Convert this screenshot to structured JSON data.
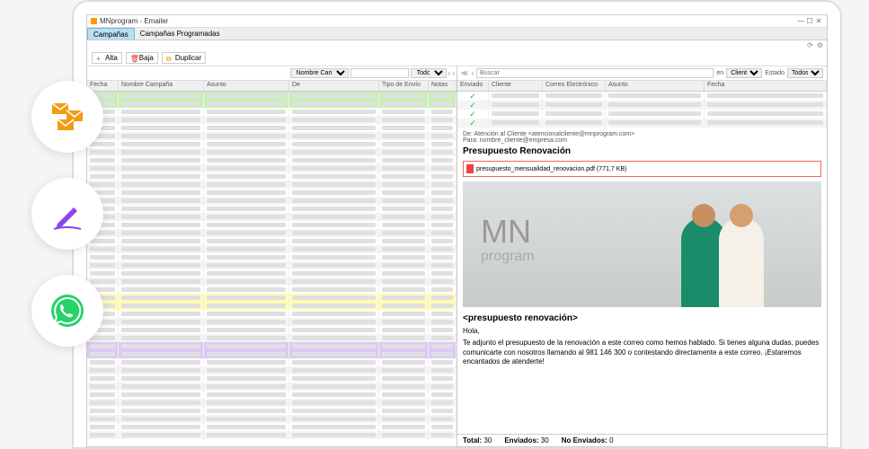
{
  "window": {
    "title": "MNprogram - Emailer"
  },
  "tabs": {
    "active": "Campañas",
    "other": "Campañas Programadas"
  },
  "toolbar": {
    "alta": "Alta",
    "baja": "Baja",
    "duplicar": "Duplicar"
  },
  "left_filters": {
    "nombre_label": "Nombre Campañ",
    "todos": "Todos"
  },
  "left_headers": {
    "fecha": "Fecha",
    "nombre": "Nombre Campaña",
    "asunto": "Asunto",
    "de": "De",
    "tipo": "Tipo de Envío",
    "notas": "Notas"
  },
  "right_filters": {
    "buscar_ph": "Buscar",
    "en": "en",
    "cliente": "Cliente",
    "estado": "Estado",
    "todos": "Todos"
  },
  "right_headers": {
    "enviado": "Enviado",
    "cliente": "Cliente",
    "correo": "Correo Electrónico",
    "asunto": "Asunto",
    "fecha": "Fecha"
  },
  "preview": {
    "from": "De: Atención al Cliente <atencionalcliente@mnprogram.com>",
    "to": "Para: nombre_cliente@empresa.com",
    "subject": "Presupuesto Renovación",
    "attachment": "presupuesto_mensualidad_renovacion.pdf (771,7 KB)",
    "body_title": "<presupuesto renovación>",
    "greeting": "Hola,",
    "body_text": "Te adjunto el presupuesto de la renovación a este correo como hemos hablado. Si tienes alguna dudas, puedes comunicarte con nosotros llamando al 981 146 300 o contestando directamente a este correo. ¡Estaremos encantados de atenderte!"
  },
  "footer": {
    "total_lbl": "Total:",
    "total_val": "30",
    "env_lbl": "Enviados:",
    "env_val": "30",
    "noenv_lbl": "No Enviados:",
    "noenv_val": "0"
  }
}
